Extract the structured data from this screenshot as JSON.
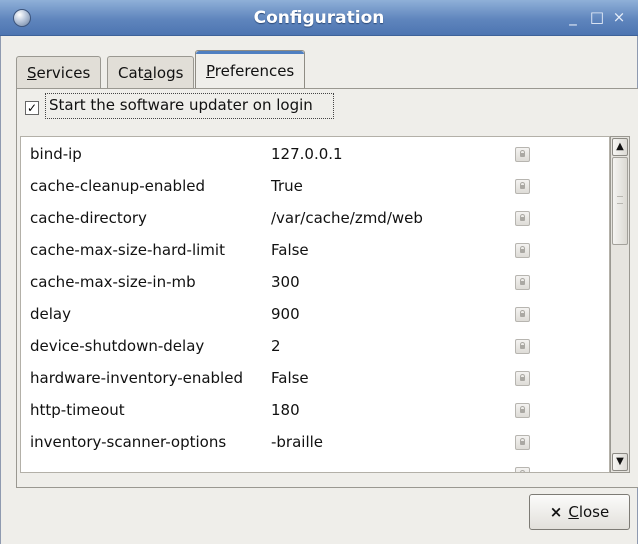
{
  "window": {
    "title": "Configuration",
    "icon": "app-globe-icon",
    "controls": {
      "minimize": "_",
      "maximize": "□",
      "close": "×"
    }
  },
  "tabs": [
    {
      "pre": "",
      "mnemonic": "S",
      "post": "ervices",
      "active": false
    },
    {
      "pre": "Cat",
      "mnemonic": "a",
      "post": "logs",
      "active": false
    },
    {
      "pre": "",
      "mnemonic": "P",
      "post": "references",
      "active": true
    }
  ],
  "preferences": {
    "start_updater": {
      "label": "Start the software updater on login",
      "checked": true
    }
  },
  "settings": [
    {
      "key": "bind-ip",
      "value": "127.0.0.1"
    },
    {
      "key": "cache-cleanup-enabled",
      "value": "True"
    },
    {
      "key": "cache-directory",
      "value": "/var/cache/zmd/web"
    },
    {
      "key": "cache-max-size-hard-limit",
      "value": "False"
    },
    {
      "key": "cache-max-size-in-mb",
      "value": "300"
    },
    {
      "key": "delay",
      "value": "900"
    },
    {
      "key": "device-shutdown-delay",
      "value": "2"
    },
    {
      "key": "hardware-inventory-enabled",
      "value": "False"
    },
    {
      "key": "http-timeout",
      "value": "180"
    },
    {
      "key": "inventory-scanner-options",
      "value": "-braille"
    }
  ],
  "buttons": {
    "close": {
      "icon": "×",
      "mnemonic": "C",
      "post": "lose"
    }
  }
}
